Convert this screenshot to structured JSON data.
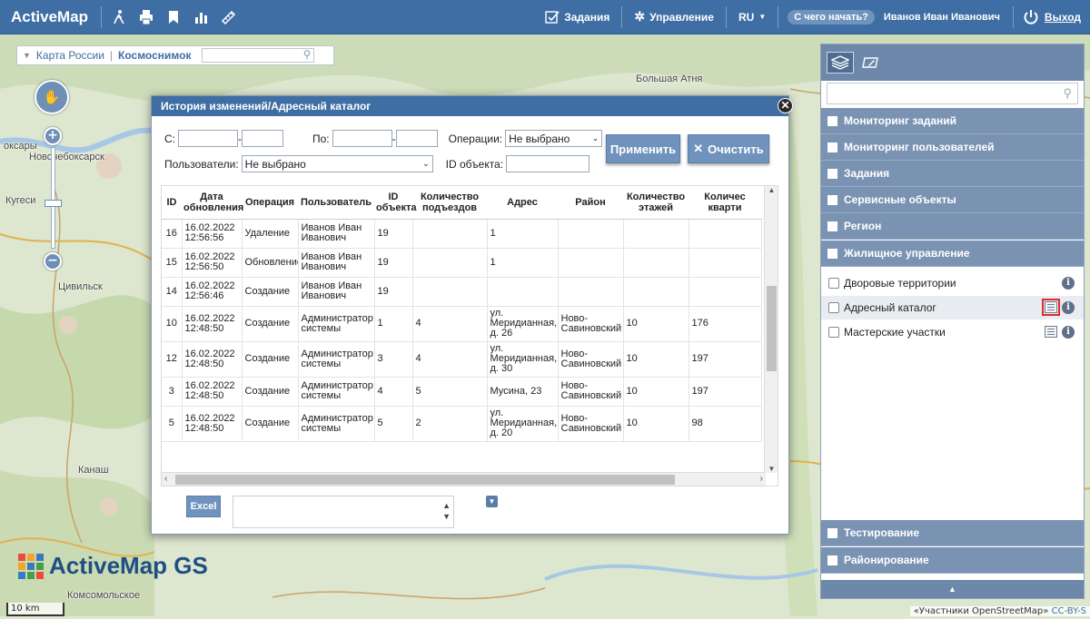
{
  "topbar": {
    "brand": "ActiveMap",
    "tasks_label": "Задания",
    "manage_label": "Управление",
    "lang_label": "RU",
    "help_label": "С чего начать?",
    "user_name": "Иванов Иван Иванович",
    "exit_label": "Выход"
  },
  "layers": {
    "option1": "Карта России",
    "option2": "Космоснимок"
  },
  "map": {
    "labels": [
      "Большая Атня",
      "оксары",
      "Новочебоксарск",
      "Кугеси",
      "Цивильск",
      "Канаш",
      "Комсомольское"
    ],
    "scale": "10 km",
    "attribution_text": "«Участники OpenStreetMap»",
    "attribution_link": "CC-BY-S"
  },
  "logo": {
    "text": "ActiveMap GS"
  },
  "dialog": {
    "title": "История изменений/Адресный каталог",
    "from_label": "С:",
    "to_label": "По:",
    "ops_label": "Операции:",
    "ops_value": "Не выбрано",
    "users_label": "Пользователи:",
    "users_value": "Не выбрано",
    "objid_label": "ID объекта:",
    "apply_label": "Применить",
    "clear_label": "Очистить",
    "excel_label": "Excel",
    "columns": [
      "ID",
      "Дата обновления",
      "Операция",
      "Пользователь",
      "ID объекта",
      "Количество подъездов",
      "Адрес",
      "Район",
      "Количество этажей",
      "Количес кварти"
    ],
    "rows": [
      {
        "id": "16",
        "date": "16.02.2022 12:56:56",
        "op": "Удаление",
        "user": "Иванов Иван Иванович",
        "objid": "19",
        "entr": "",
        "addr": "1",
        "district": "",
        "floors": "",
        "flats": ""
      },
      {
        "id": "15",
        "date": "16.02.2022 12:56:50",
        "op": "Обновление",
        "user": "Иванов Иван Иванович",
        "objid": "19",
        "entr": "",
        "addr": "1",
        "district": "",
        "floors": "",
        "flats": ""
      },
      {
        "id": "14",
        "date": "16.02.2022 12:56:46",
        "op": "Создание",
        "user": "Иванов Иван Иванович",
        "objid": "19",
        "entr": "",
        "addr": "",
        "district": "",
        "floors": "",
        "flats": ""
      },
      {
        "id": "10",
        "date": "16.02.2022 12:48:50",
        "op": "Создание",
        "user": "Администратор системы",
        "objid": "1",
        "entr": "4",
        "addr": "ул. Меридианная, д. 26",
        "district": "Ново-Савиновский",
        "floors": "10",
        "flats": "176"
      },
      {
        "id": "12",
        "date": "16.02.2022 12:48:50",
        "op": "Создание",
        "user": "Администратор системы",
        "objid": "3",
        "entr": "4",
        "addr": "ул. Меридианная, д. 30",
        "district": "Ново-Савиновский",
        "floors": "10",
        "flats": "197"
      },
      {
        "id": "3",
        "date": "16.02.2022 12:48:50",
        "op": "Создание",
        "user": "Администратор системы",
        "objid": "4",
        "entr": "5",
        "addr": "Мусина, 23",
        "district": "Ново-Савиновский",
        "floors": "10",
        "flats": "197"
      },
      {
        "id": "5",
        "date": "16.02.2022 12:48:50",
        "op": "Создание",
        "user": "Администратор системы",
        "objid": "5",
        "entr": "2",
        "addr": "ул. Меридианная, д. 20",
        "district": "Ново-Савиновский",
        "floors": "10",
        "flats": "98"
      }
    ]
  },
  "panel": {
    "sections_top": [
      "Мониторинг заданий",
      "Мониторинг пользователей",
      "Задания",
      "Сервисные объекты",
      "Регион",
      "Жилищное управление"
    ],
    "subitems": [
      "Дворовые территории",
      "Адресный каталог",
      "Мастерские участки"
    ],
    "sections_bottom": [
      "Тестирование",
      "Районирование"
    ]
  },
  "colors": {
    "topbar": "#3e6ea3",
    "section": "#7b93b3",
    "button": "#6f93bd",
    "highlight": "#e22d2d"
  }
}
